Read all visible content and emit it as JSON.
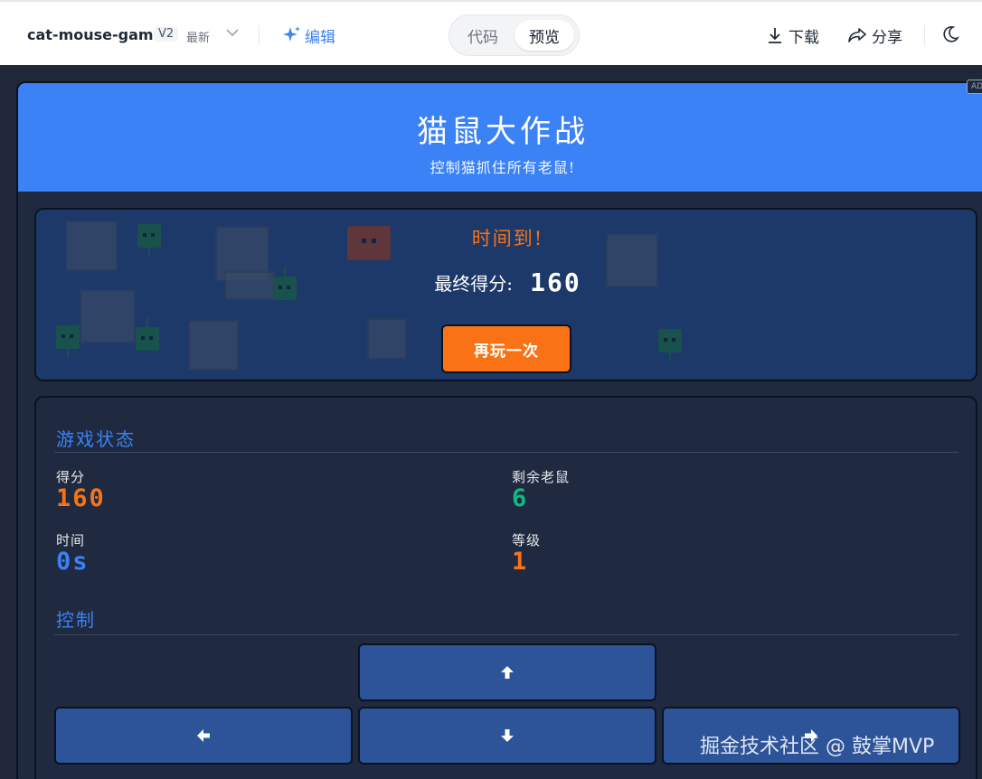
{
  "toolbar": {
    "project_name": "cat-mouse-game",
    "version": "V2",
    "version_status": "最新",
    "edit_label": "编辑",
    "tabs": [
      {
        "label": "代码",
        "active": false
      },
      {
        "label": "预览",
        "active": true
      }
    ],
    "download_label": "下载",
    "share_label": "分享"
  },
  "game": {
    "title": "猫鼠大作战",
    "subtitle": "控制猫抓住所有老鼠!",
    "ad_badge": "AD",
    "game_over": {
      "message": "时间到!",
      "final_score_label": "最终得分:",
      "final_score": "160",
      "replay_label": "再玩一次"
    }
  },
  "status": {
    "section_title": "游戏状态",
    "score_label": "得分",
    "score_value": "160",
    "remaining_label": "剩余老鼠",
    "remaining_value": "6",
    "time_label": "时间",
    "time_value": "0s",
    "level_label": "等级",
    "level_value": "1"
  },
  "controls": {
    "section_title": "控制",
    "buttons": [
      "up",
      "left",
      "down",
      "right"
    ]
  },
  "watermark": "掘金技术社区 @ 鼓掌MVP",
  "colors": {
    "accent_blue": "#3b82f6",
    "accent_orange": "#f97316",
    "accent_green": "#10b981",
    "panel_bg": "#1f2a40"
  }
}
